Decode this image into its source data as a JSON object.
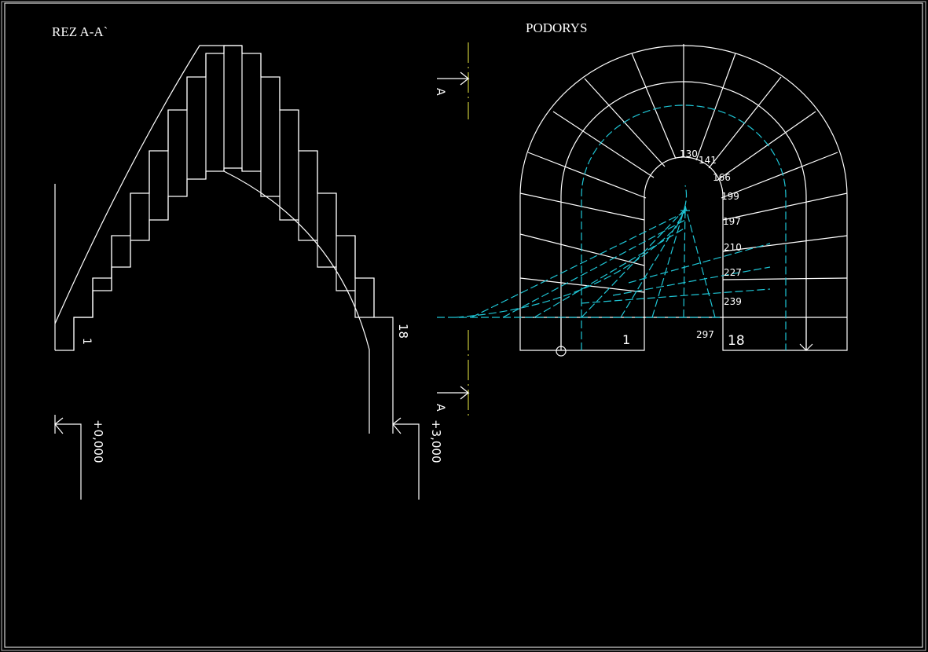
{
  "section": {
    "title": "REZ A-A`",
    "step_first": "1",
    "step_last": "18",
    "level_start": "+0,000",
    "level_end": "+3,000"
  },
  "plan": {
    "title": "PODORYS",
    "cut_mark_top": "A",
    "cut_mark_bottom": "A",
    "step_first": "1",
    "step_last": "18",
    "dims": [
      "130",
      "141",
      "166",
      "199",
      "197",
      "210",
      "227",
      "239",
      "297"
    ]
  },
  "colors": {
    "background": "#000000",
    "lines": "#ffffff",
    "construction": "#1fc6d6",
    "cut_line": "#c8c83a"
  }
}
